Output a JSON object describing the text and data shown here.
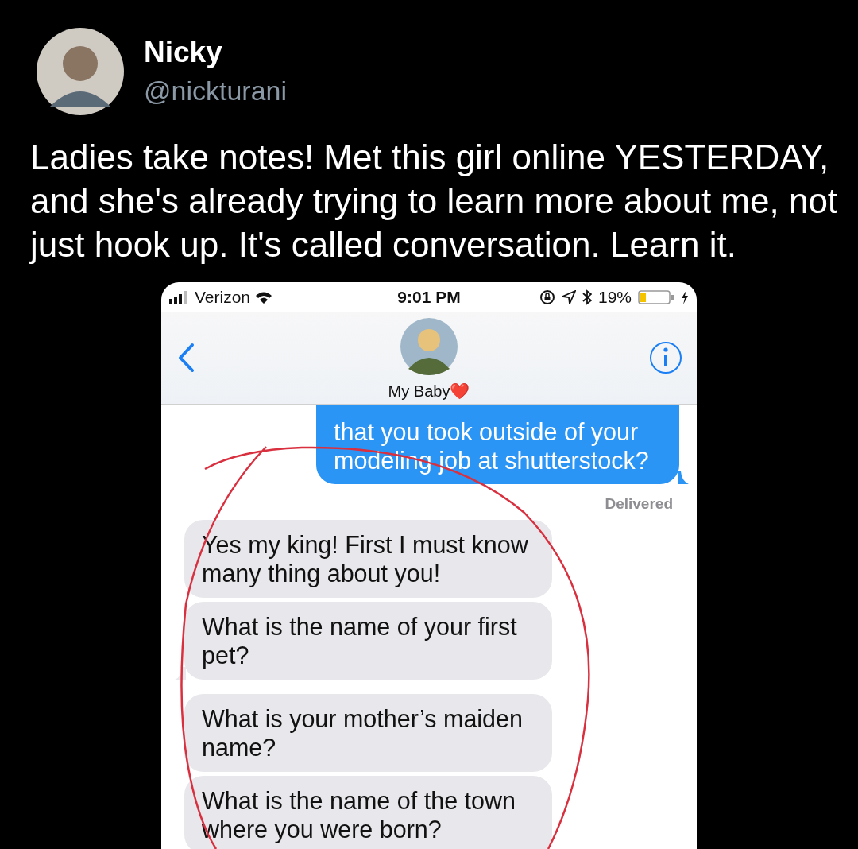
{
  "author": {
    "name": "Nicky",
    "handle": "@nickturani"
  },
  "tweet_text": "Ladies take notes! Met this girl online YESTERDAY, and she's already trying to learn more about me, not just hook up. It's called conversation. Learn it.",
  "phone": {
    "status_bar": {
      "carrier": "Verizon",
      "time": "9:01 PM",
      "battery": "19%"
    },
    "contact": {
      "name": "My Baby❤️"
    },
    "messages": [
      {
        "kind": "sent",
        "text": "that you took outside of your modeling job at shutterstock?",
        "tail": true
      },
      {
        "kind": "status",
        "text": "Delivered"
      },
      {
        "kind": "received",
        "text": "Yes my king! First I must know many thing about you!",
        "tail": false
      },
      {
        "kind": "received",
        "text": "What is the name of your first pet?",
        "tail": true
      },
      {
        "kind": "received",
        "text": "What is your mother’s maiden name?",
        "tail": false
      },
      {
        "kind": "received",
        "text": "What is the name of the town where you were born?",
        "tail": false
      }
    ]
  }
}
